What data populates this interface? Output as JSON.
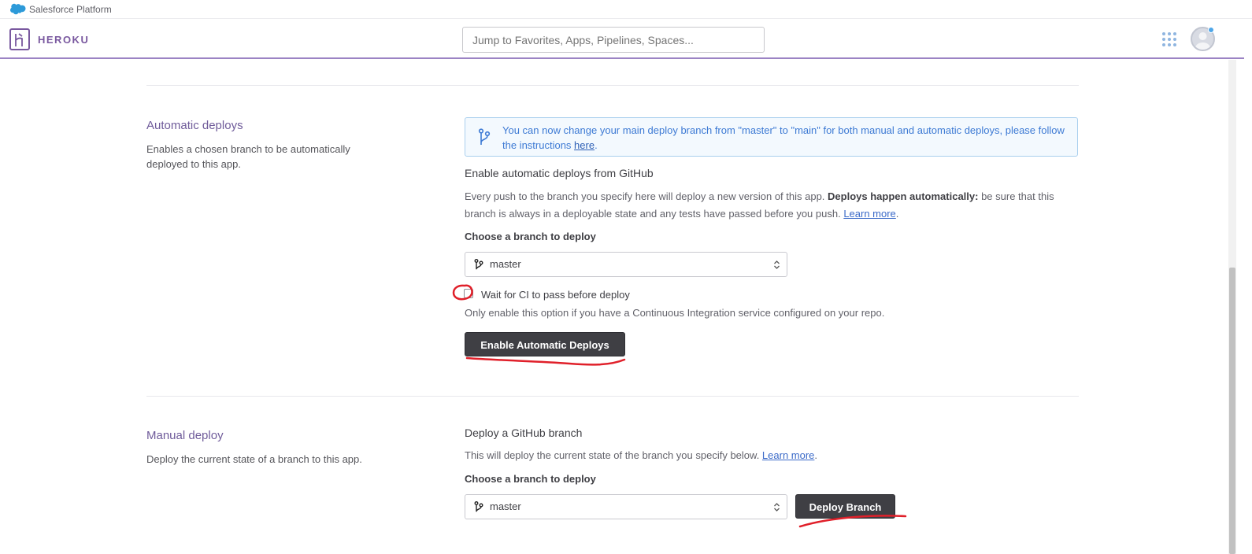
{
  "platform_bar": {
    "text": "Salesforce Platform",
    "logo_icon": "salesforce-cloud-icon"
  },
  "header": {
    "brand": "HEROKU",
    "search_placeholder": "Jump to Favorites, Apps, Pipelines, Spaces...",
    "apps_icon": "grid-apps-icon",
    "avatar_icon": "user-avatar-icon"
  },
  "automatic_deploys": {
    "title": "Automatic deploys",
    "description": "Enables a chosen branch to be automatically deployed to this app.",
    "notice": {
      "text_before": "You can now change your main deploy branch from \"master\" to \"main\" for both manual and automatic deploys, please follow the instructions ",
      "link": "here",
      "text_after": "."
    },
    "subtitle": "Enable automatic deploys from GitHub",
    "body_part1": "Every push to the branch you specify here will deploy a new version of this app. ",
    "body_bold": "Deploys happen automatically:",
    "body_part2": " be sure that this branch is always in a deployable state and any tests have passed before you push. ",
    "learn_more": "Learn more",
    "body_end": ".",
    "branch_label": "Choose a branch to deploy",
    "branch_value": "master",
    "ci_checkbox_label": "Wait for CI to pass before deploy",
    "ci_checkbox_checked": false,
    "ci_hint": "Only enable this option if you have a Continuous Integration service configured on your repo.",
    "button": "Enable Automatic Deploys"
  },
  "manual_deploy": {
    "title": "Manual deploy",
    "description": "Deploy the current state of a branch to this app.",
    "subtitle": "Deploy a GitHub branch",
    "body": "This will deploy the current state of the branch you specify below. ",
    "learn_more": "Learn more",
    "body_end": ".",
    "branch_label": "Choose a branch to deploy",
    "branch_value": "master",
    "button": "Deploy Branch"
  },
  "colors": {
    "brand_purple": "#79589f",
    "button_dark": "#3f3f44",
    "notice_blue": "#3d7ad4",
    "annotation_red": "#e0202a"
  }
}
